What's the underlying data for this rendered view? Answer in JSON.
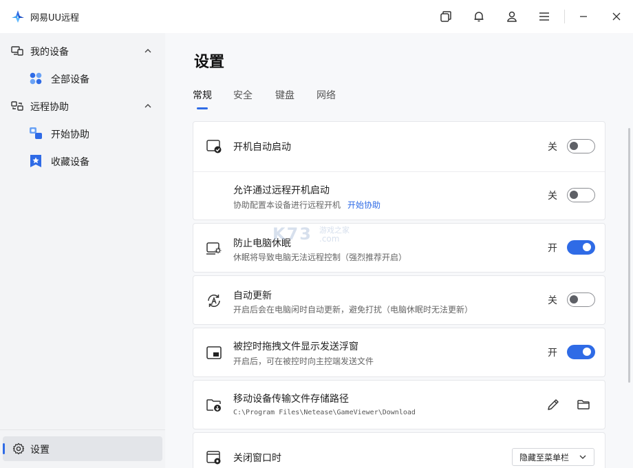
{
  "app": {
    "title": "网易UU远程"
  },
  "sidebar": {
    "groups": [
      {
        "label": "我的设备",
        "items": [
          {
            "label": "全部设备"
          }
        ]
      },
      {
        "label": "远程协助",
        "items": [
          {
            "label": "开始协助"
          },
          {
            "label": "收藏设备"
          }
        ]
      }
    ],
    "settings_label": "设置"
  },
  "main": {
    "title": "设置",
    "tabs": [
      {
        "label": "常规",
        "active": true
      },
      {
        "label": "安全",
        "active": false
      },
      {
        "label": "键盘",
        "active": false
      },
      {
        "label": "网络",
        "active": false
      }
    ],
    "settings": [
      {
        "title": "开机自动启动",
        "state_label": "关",
        "on": false
      },
      {
        "title": "允许通过远程开机启动",
        "subtitle": "协助配置本设备进行远程开机",
        "link": "开始协助",
        "state_label": "关",
        "on": false
      },
      {
        "title": "防止电脑休眠",
        "subtitle": "休眠将导致电脑无法远程控制（强烈推荐开启）",
        "state_label": "开",
        "on": true
      },
      {
        "title": "自动更新",
        "subtitle": "开启后会在电脑闲时自动更新，避免打扰（电脑休眠时无法更新）",
        "state_label": "关",
        "on": false
      },
      {
        "title": "被控时拖拽文件显示发送浮窗",
        "subtitle": "开启后，可在被控时向主控端发送文件",
        "state_label": "开",
        "on": true
      },
      {
        "title": "移动设备传输文件存储路径",
        "path": "C:\\Program Files\\Netease\\GameViewer\\Download"
      },
      {
        "title": "关闭窗口时",
        "select_value": "隐藏至菜单栏"
      }
    ]
  },
  "watermark": {
    "text": "K73",
    "sub": "游戏之家",
    "domain": ".com"
  },
  "colors": {
    "accent": "#2f6be6",
    "sidebar_bg": "#f3f4f6",
    "main_bg": "#f7f8fa"
  },
  "icons": [
    "app-logo-icon",
    "window-copy-icon",
    "bell-icon",
    "user-icon",
    "menu-icon",
    "minimize-icon",
    "close-icon",
    "devices-icon",
    "chevron-up-icon",
    "all-devices-icon",
    "remote-assist-icon",
    "start-assist-icon",
    "favorite-icon",
    "gear-icon",
    "monitor-check-icon",
    "monitor-sun-icon",
    "auto-update-icon",
    "floating-window-icon",
    "folder-download-icon",
    "edit-icon",
    "folder-icon",
    "window-gear-icon",
    "chevron-down-icon"
  ]
}
